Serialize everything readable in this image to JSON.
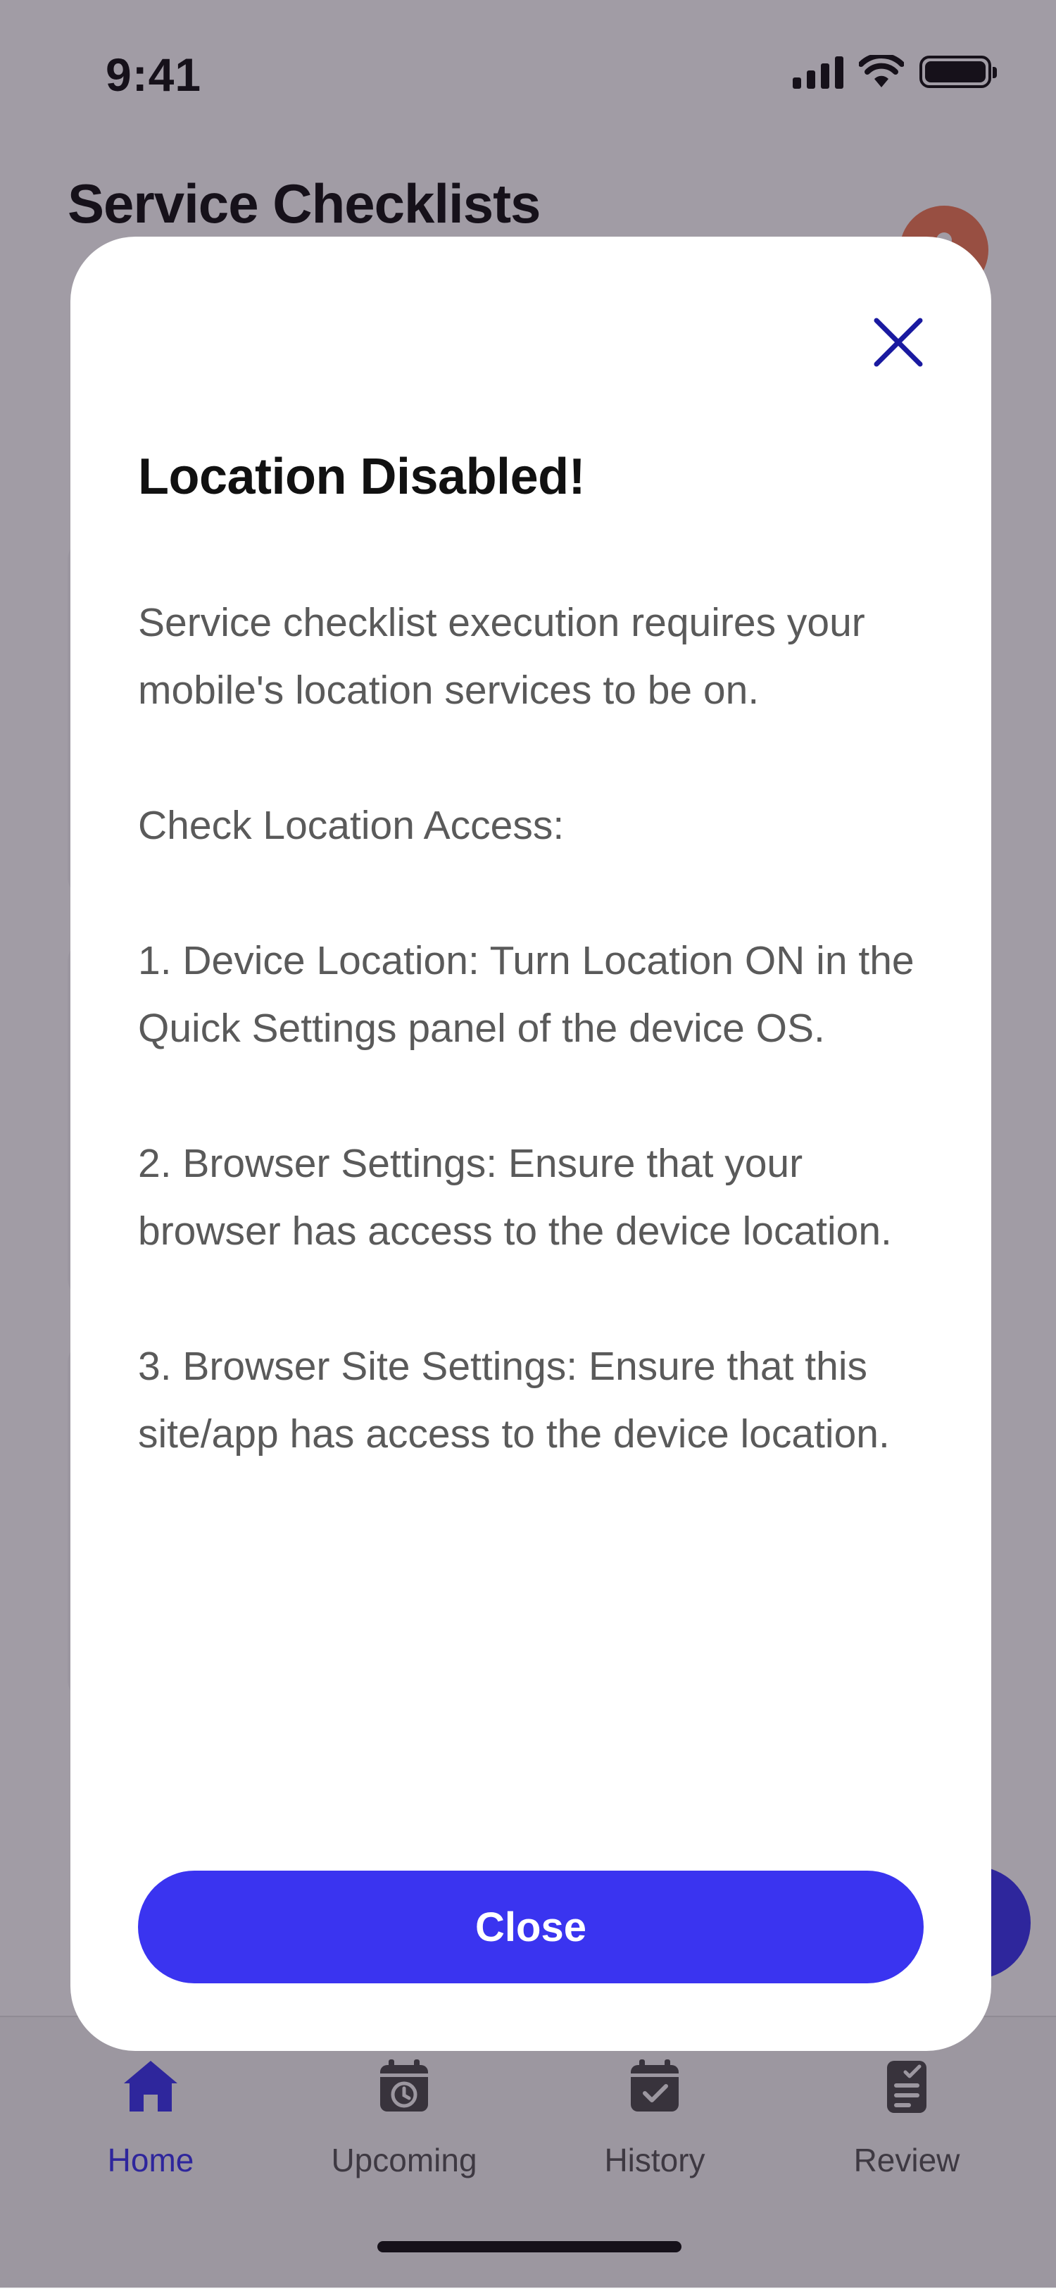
{
  "status_bar": {
    "time": "9:41"
  },
  "header": {
    "title": "Service Checklists"
  },
  "nav": {
    "items": [
      {
        "label": "Home",
        "icon": "home-icon",
        "active": true
      },
      {
        "label": "Upcoming",
        "icon": "calendar-clock-icon",
        "active": false
      },
      {
        "label": "History",
        "icon": "calendar-check-icon",
        "active": false
      },
      {
        "label": "Review",
        "icon": "clipboard-check-icon",
        "active": false
      }
    ]
  },
  "modal": {
    "title": "Location Disabled!",
    "paragraphs": [
      "Service checklist execution requires your mobile's location services to be on.",
      "Check Location Access:",
      "1. Device Location: Turn Location ON in the Quick Settings panel of the device OS.",
      "2. Browser Settings: Ensure that your browser has access to the device location.",
      "3. Browser Site Settings: Ensure that this site/app has access to the device location."
    ],
    "close_label": "Close",
    "close_icon": "close-icon"
  },
  "colors": {
    "accent": "#3a34f0",
    "avatar": "#f07a55",
    "close_icon": "#1a1aa0"
  }
}
